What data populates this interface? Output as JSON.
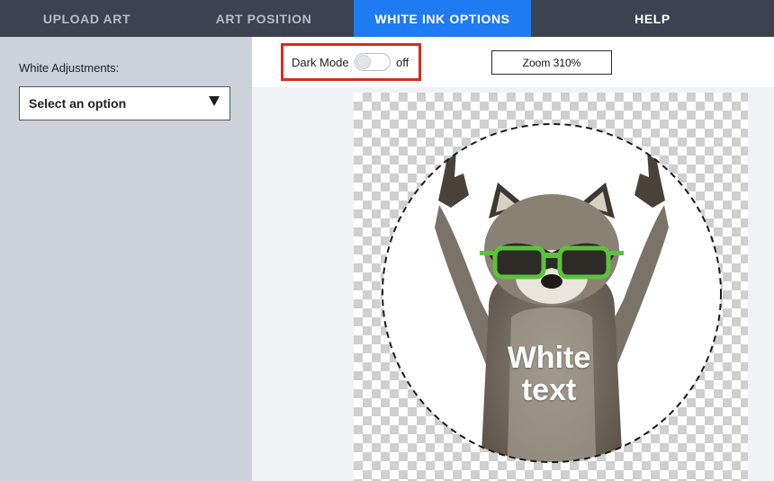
{
  "nav": {
    "tabs": [
      {
        "label": "UPLOAD ART"
      },
      {
        "label": "ART POSITION"
      },
      {
        "label": "WHITE INK OPTIONS"
      },
      {
        "label": "HELP"
      }
    ],
    "active_tab": "WHITE INK OPTIONS"
  },
  "sidebar": {
    "label": "White Adjustments:",
    "select": {
      "value": "Select an option"
    }
  },
  "toolbar": {
    "dark_mode_label": "Dark Mode",
    "dark_mode_state": "off",
    "zoom_label": "Zoom 310%"
  },
  "canvas": {
    "overlay_text_line1": "White",
    "overlay_text_line2": "text"
  },
  "colors": {
    "nav_bg": "#3d4250",
    "active_tab": "#1f7bf2",
    "sidebar_bg": "#cdd1d9",
    "highlight_border": "#d72c1f",
    "glasses": "#5cc23c"
  },
  "icons": {
    "select_caret": "caret-down-icon",
    "toggle": "toggle-switch"
  }
}
